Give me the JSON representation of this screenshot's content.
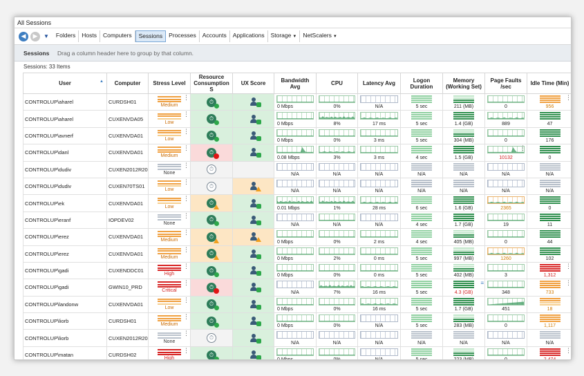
{
  "window": {
    "title": "All Sessions"
  },
  "toolbar": {
    "back_icon": "arrow-left-icon",
    "forward_icon": "arrow-right-icon",
    "tabs": [
      {
        "label": "Folders"
      },
      {
        "label": "Hosts"
      },
      {
        "label": "Computers"
      },
      {
        "label": "Sessions",
        "active": true
      },
      {
        "label": "Processes"
      },
      {
        "label": "Accounts"
      },
      {
        "label": "Applications"
      },
      {
        "label": "Storage",
        "dropdown": true
      },
      {
        "label": "NetScalers",
        "dropdown": true
      }
    ]
  },
  "groupbar": {
    "label": "Sessions",
    "hint": "Drag a column header here to group by that column."
  },
  "count": "Sessions: 33 Items",
  "columns": {
    "user": "User",
    "computer": "Computer",
    "stress": "Stress Level",
    "resource": "Resource Consumption S",
    "ux": "UX Score",
    "bandwidth": "Bandwidth Avg",
    "cpu": "CPU",
    "latency": "Latency Avg",
    "logon": "Logon Duration",
    "memory": "Memory (Working Set)",
    "pagefaults": "Page Faults /sec",
    "idle": "Idle Time (Min)"
  },
  "colors": {
    "accent": "#3f7fc2",
    "good": "#2f8f4e",
    "warn": "#f0a040",
    "bad": "#d72424"
  },
  "rows": [
    {
      "user": "CONTROLUP\\aharel",
      "computer": "CURDSH01",
      "stress": "Medium",
      "rc": "ok",
      "ux": "ok",
      "bandwidth": "0 Mbps",
      "cpu": "0%",
      "latency": "N/A",
      "logon": "5 sec",
      "memory": "211 (MB)",
      "pagefaults": "0",
      "idle": "956",
      "idle_level": "amber"
    },
    {
      "user": "CONTROLUP\\aharel",
      "computer": "CUXENVDA05",
      "stress": "Low",
      "rc": "ok",
      "ux": "ok",
      "bandwidth": "0 Mbps",
      "cpu": "8%",
      "latency": "17 ms",
      "logon": "5 sec",
      "memory": "1.4 (GB)",
      "pagefaults": "889",
      "idle": "47",
      "idle_level": "green"
    },
    {
      "user": "CONTROLUP\\avnerf",
      "computer": "CUXENVDA01",
      "stress": "Low",
      "rc": "ok",
      "ux": "ok",
      "bandwidth": "0 Mbps",
      "cpu": "0%",
      "latency": "3 ms",
      "logon": "5 sec",
      "memory": "304 (MB)",
      "pagefaults": "0",
      "idle": "176",
      "idle_level": "green"
    },
    {
      "user": "CONTROLUP\\danl",
      "computer": "CUXENVDA01",
      "stress": "Medium",
      "rc": "red",
      "ux": "ok",
      "bandwidth": "0.08 Mbps",
      "cpu": "3%",
      "latency": "3 ms",
      "logon": "4 sec",
      "memory": "1.5 (GB)",
      "pagefaults": "10132",
      "pagefaults_alert": "red",
      "idle": "0",
      "idle_level": "green"
    },
    {
      "user": "CONTROLUP\\dudiv",
      "computer": "CUXEN2012R202",
      "stress": "None",
      "rc": "none",
      "ux": "none",
      "bandwidth": "N/A",
      "cpu": "N/A",
      "latency": "N/A",
      "logon": "N/A",
      "memory": "N/A",
      "pagefaults": "N/A",
      "idle": "N/A",
      "idle_level": "grey",
      "na": true
    },
    {
      "user": "CONTROLUP\\dudiv",
      "computer": "CUXEN70TS01",
      "stress": "Low",
      "rc": "none",
      "ux": "amber",
      "bandwidth": "N/A",
      "cpu": "N/A",
      "latency": "N/A",
      "logon": "N/A",
      "memory": "N/A",
      "pagefaults": "N/A",
      "idle": "N/A",
      "idle_level": "grey",
      "na": true
    },
    {
      "user": "CONTROLUP\\ek",
      "computer": "CUXENVDA01",
      "stress": "Low",
      "rc": "amber",
      "ux": "ok",
      "bandwidth": "0.01 Mbps",
      "cpu": "1%",
      "latency": "28 ms",
      "logon": "6 sec",
      "memory": "1.6 (GB)",
      "pagefaults": "2365",
      "pagefaults_alert": "orange",
      "idle": "0",
      "idle_level": "green"
    },
    {
      "user": "CONTROLUP\\eranf",
      "computer": "IOPDEV02",
      "stress": "None",
      "rc": "ok",
      "ux": "ok",
      "bandwidth": "N/A",
      "cpu": "N/A",
      "latency": "N/A",
      "logon": "4 sec",
      "memory": "1.7 (GB)",
      "pagefaults": "19",
      "idle": "11",
      "idle_level": "green"
    },
    {
      "user": "CONTROLUP\\erez",
      "computer": "CUXENVDA01",
      "stress": "Medium",
      "rc": "amber",
      "ux": "amber",
      "bandwidth": "0 Mbps",
      "cpu": "0%",
      "latency": "2 ms",
      "logon": "4 sec",
      "memory": "405 (MB)",
      "pagefaults": "0",
      "idle": "44",
      "idle_level": "green"
    },
    {
      "user": "CONTROLUP\\erez",
      "computer": "CUXENVDA01",
      "stress": "Medium",
      "rc": "amber",
      "ux": "ok",
      "bandwidth": "0 Mbps",
      "cpu": "2%",
      "latency": "0 ms",
      "logon": "5 sec",
      "memory": "997 (MB)",
      "pagefaults": "1260",
      "pagefaults_alert": "orange",
      "idle": "102",
      "idle_level": "green"
    },
    {
      "user": "CONTROLUP\\gadi",
      "computer": "CUXENDDC01",
      "stress": "High",
      "rc": "ok",
      "ux": "ok",
      "bandwidth": "0 Mbps",
      "cpu": "0%",
      "latency": "0 ms",
      "logon": "5 sec",
      "memory": "402 (MB)",
      "pagefaults": "3",
      "idle": "1,312",
      "idle_level": "red"
    },
    {
      "user": "CONTROLUP\\gadi",
      "computer": "GWIN10_PRD",
      "stress": "Critical",
      "rc": "red",
      "ux": "ok",
      "bandwidth": "N/A",
      "cpu": "7%",
      "latency": "16 ms",
      "logon": "5 sec",
      "memory": "4.3 (GB)",
      "memory_alert": "red",
      "pagefaults": "348",
      "idle": "733",
      "idle_level": "amber"
    },
    {
      "user": "CONTROLUP\\landonw",
      "computer": "CUXENVDA01",
      "stress": "Low",
      "rc": "ok",
      "ux": "ok",
      "bandwidth": "0 Mbps",
      "cpu": "0%",
      "latency": "16 ms",
      "logon": "5 sec",
      "memory": "1.7 (GB)",
      "pagefaults": "451",
      "idle": "18",
      "idle_level": "amber"
    },
    {
      "user": "CONTROLUP\\liorb",
      "computer": "CURDSH01",
      "stress": "Medium",
      "rc": "ok",
      "ux": "ok",
      "bandwidth": "0 Mbps",
      "cpu": "0%",
      "latency": "N/A",
      "logon": "5 sec",
      "memory": "283 (MB)",
      "pagefaults": "0",
      "idle": "1,117",
      "idle_level": "amber"
    },
    {
      "user": "CONTROLUP\\liorb",
      "computer": "CUXEN2012R202",
      "stress": "None",
      "rc": "none",
      "ux": "ok",
      "bandwidth": "N/A",
      "cpu": "N/A",
      "latency": "N/A",
      "logon": "N/A",
      "memory": "N/A",
      "pagefaults": "N/A",
      "idle": "N/A",
      "idle_level": "grey",
      "na": true
    },
    {
      "user": "CONTROLUP\\matan",
      "computer": "CURDSH02",
      "stress": "High",
      "rc": "ok",
      "ux": "ok",
      "bandwidth": "0 Mbps",
      "cpu": "0%",
      "latency": "N/A",
      "logon": "5 sec",
      "memory": "223 (MB)",
      "pagefaults": "0",
      "idle": "2,474",
      "idle_level": "red"
    }
  ]
}
